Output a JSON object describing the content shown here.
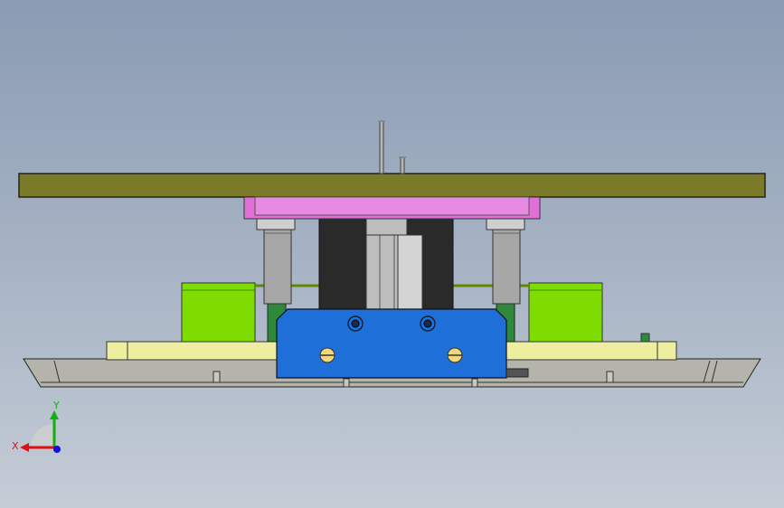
{
  "viewport": {
    "background_top": "#8a9bb3",
    "background_bottom": "#c4ccd6"
  },
  "colors": {
    "top_plate": "#7a7a28",
    "pink_block": "#e070d8",
    "blue_block": "#1f6fd8",
    "green_block": "#7fdc00",
    "yellow_rail": "#eeeea0",
    "base_plate": "#b4b4aa",
    "dark_body": "#2a2a2a",
    "gray_cylinder": "#a7a7a7",
    "dark_green_bracket": "#2e8a3a"
  },
  "triad": {
    "x_label": "X",
    "y_label": "Y",
    "x_color": "#e01010",
    "y_color": "#10b010",
    "z_color": "#1010e0",
    "icon": "reference-triad-icon"
  }
}
